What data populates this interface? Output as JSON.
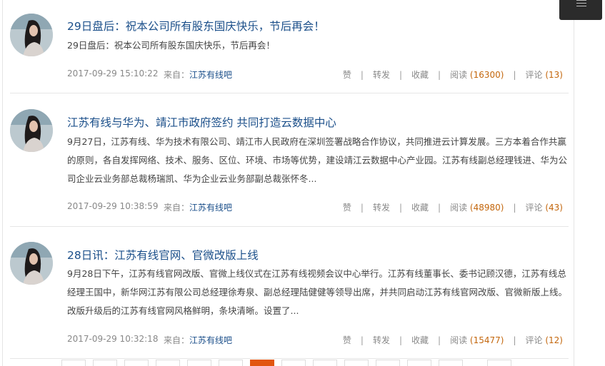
{
  "posts": [
    {
      "title": "29日盘后：祝本公司所有股东国庆快乐，节后再会！",
      "summary": "29日盘后：祝本公司所有股东国庆快乐，节后再会！",
      "date": "2017-09-29 15:10:22",
      "source_label": "来自：",
      "source": "江苏有线吧",
      "like": "赞",
      "share": "转发",
      "fav": "收藏",
      "read_label": "阅读",
      "read_count": "(16300)",
      "comment_label": "评论",
      "comment_count": "(13)"
    },
    {
      "title": "江苏有线与华为、靖江市政府签约 共同打造云数据中心",
      "summary": "9月27日，江苏有线、华为技术有限公司、靖江市人民政府在深圳签署战略合作协议，共同推进云计算发展。三方本着合作共赢的原则，各自发挥网络、技术、服务、区位、环境、市场等优势，建设靖江云数据中心产业园。江苏有线副总经理钱进、华为公司企业云业务部总裁杨瑞凯、华为企业云业务部副总裁张怀冬...",
      "date": "2017-09-29 10:38:59",
      "source_label": "来自：",
      "source": "江苏有线吧",
      "like": "赞",
      "share": "转发",
      "fav": "收藏",
      "read_label": "阅读",
      "read_count": "(48980)",
      "comment_label": "评论",
      "comment_count": "(43)"
    },
    {
      "title": "28日讯：江苏有线官网、官微改版上线",
      "summary": "9月28日下午，江苏有线官网改版、官微上线仪式在江苏有线视频会议中心举行。江苏有线董事长、委书记顾汉德，江苏有线总经理王国中，新华网江苏有限公司总经理徐寿泉、副总经理陆健健等领导出席，并共同启动江苏有线官网改版、官微新版上线。 改版升级后的江苏有线官网风格鲜明，条块清晰。设置了...",
      "date": "2017-09-29 10:32:18",
      "source_label": "来自：",
      "source": "江苏有线吧",
      "like": "赞",
      "share": "转发",
      "fav": "收藏",
      "read_label": "阅读",
      "read_count": "(15477)",
      "comment_label": "评论",
      "comment_count": "(12)"
    }
  ],
  "menu_icon": "menu-icon",
  "colors": {
    "title": "#1b4f8a",
    "count": "#c3660c",
    "pager_active": "#e2550f"
  }
}
